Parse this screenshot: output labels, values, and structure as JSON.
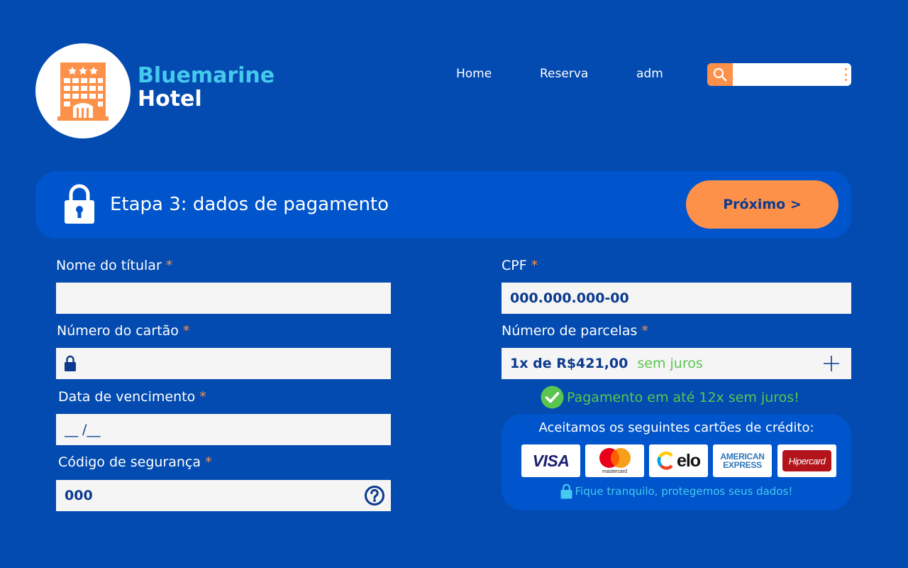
{
  "brand": {
    "line1": "Bluemarine",
    "line2": "Hotel"
  },
  "nav": {
    "home": "Home",
    "reserva": "Reserva",
    "adm": "adm"
  },
  "search": {
    "value": "",
    "placeholder": ""
  },
  "step": {
    "title": "Etapa 3: dados de pagamento",
    "next_label": "Próximo >"
  },
  "form": {
    "holder_name": {
      "label": "Nome do títular",
      "required": "*",
      "value": ""
    },
    "card_number": {
      "label": "Número do cartão",
      "required": "*",
      "value": ""
    },
    "expiry": {
      "label": "Data de vencimento",
      "required": "*",
      "placeholder": "__ /__"
    },
    "security_code": {
      "label": "Código de segurança",
      "required": "*",
      "placeholder": "000"
    },
    "cpf": {
      "label": "CPF",
      "required": "*",
      "placeholder": "000.000.000-00"
    },
    "installments": {
      "label": "Número de parcelas",
      "required": "*",
      "value": "1x de R$421,00",
      "note": "sem juros"
    }
  },
  "promo": "Pagamento em até 12x sem juros!",
  "cards": {
    "title": "Aceitamos os seguintes cartões de crédito:",
    "brands": [
      "VISA",
      "mastercard",
      "elo",
      "AMERICAN",
      "EXPRESS",
      "Hipercard"
    ],
    "safe_note": "Fique tranquilo, protegemos seus dados!"
  },
  "colors": {
    "background": "#034bb0",
    "panel": "#0055cc",
    "accent": "#fe914a",
    "brand_light": "#46c9ee",
    "success": "#5ac54f",
    "text_dark": "#0b3a8f"
  }
}
